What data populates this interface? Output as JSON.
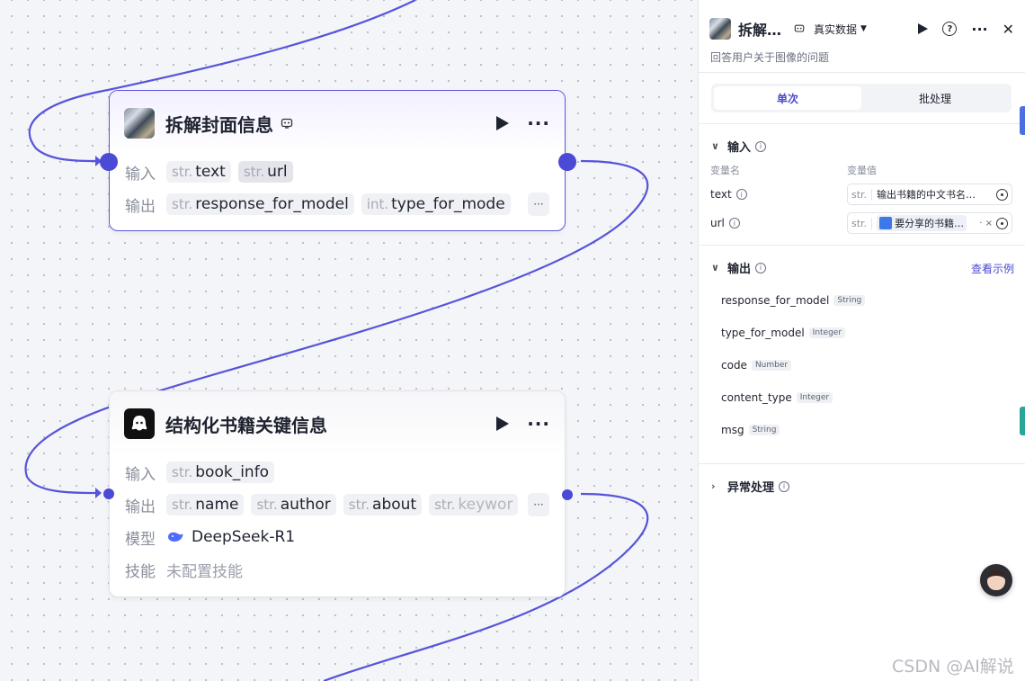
{
  "canvas": {
    "node1": {
      "title": "拆解封面信息",
      "input_label": "输入",
      "output_label": "输出",
      "inputs": [
        {
          "type": "str.",
          "name": "text"
        },
        {
          "type": "str.",
          "name": "url"
        }
      ],
      "outputs": [
        {
          "type": "str.",
          "name": "response_for_model"
        },
        {
          "type": "int.",
          "name": "type_for_mode"
        }
      ],
      "more": "···"
    },
    "node2": {
      "title": "结构化书籍关键信息",
      "input_label": "输入",
      "output_label": "输出",
      "model_label": "模型",
      "skill_label": "技能",
      "inputs": [
        {
          "type": "str.",
          "name": "book_info"
        }
      ],
      "outputs": [
        {
          "type": "str.",
          "name": "name"
        },
        {
          "type": "str.",
          "name": "author"
        },
        {
          "type": "str.",
          "name": "about"
        },
        {
          "type": "str.",
          "name": "keywor"
        }
      ],
      "model": "DeepSeek-R1",
      "skill": "未配置技能",
      "more": "···"
    }
  },
  "panel": {
    "title": "拆解…",
    "data_mode": "真实数据",
    "description": "回答用户关于图像的问题",
    "tabs": [
      "单次",
      "批处理"
    ],
    "input_section": "输入",
    "col_name": "变量名",
    "col_value": "变量值",
    "inputs": [
      {
        "name": "text",
        "type": "str.",
        "value": "输出书籍的中文书名…"
      },
      {
        "name": "url",
        "type": "str.",
        "value": "要分享的书籍…"
      }
    ],
    "output_section": "输出",
    "view_example": "查看示例",
    "outputs": [
      {
        "name": "response_for_model",
        "type": "String"
      },
      {
        "name": "type_for_model",
        "type": "Integer"
      },
      {
        "name": "code",
        "type": "Number"
      },
      {
        "name": "content_type",
        "type": "Integer"
      },
      {
        "name": "msg",
        "type": "String"
      }
    ],
    "exception_section": "异常处理",
    "close": "✕",
    "help": "?",
    "more": "···"
  },
  "watermark": "CSDN @AI解说",
  "colors": {
    "accent": "#4b49d1",
    "edge": "#4a4ad6"
  }
}
